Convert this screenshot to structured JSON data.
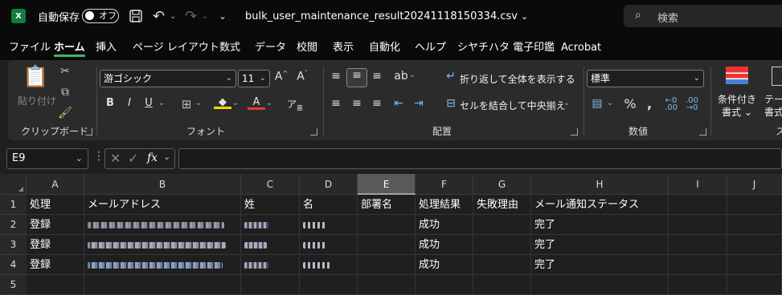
{
  "titlebar": {
    "app_logo": "X",
    "autosave_label": "自動保存",
    "autosave_state": "オフ",
    "filename": "bulk_user_maintenance_result20241118150334.csv",
    "search_placeholder": "検索"
  },
  "menu": [
    "ファイル",
    "ホーム",
    "挿入",
    "ページ レイアウト",
    "数式",
    "データ",
    "校閲",
    "表示",
    "自動化",
    "ヘルプ",
    "シヤチハタ 電子印鑑",
    "Acrobat"
  ],
  "menu_active": "ホーム",
  "ribbon": {
    "clipboard": {
      "paste_label": "貼り付け",
      "group_label": "クリップボード"
    },
    "font": {
      "font_name": "游ゴシック",
      "font_size": "11",
      "group_label": "フォント"
    },
    "alignment": {
      "wrap_label": "折り返して全体を表示する",
      "merge_label": "セルを結合して中央揃え",
      "group_label": "配置"
    },
    "number": {
      "format": "標準",
      "group_label": "数値"
    },
    "styles": {
      "conditional_line1": "条件付き",
      "conditional_line2": "書式",
      "table_line1": "テーブ",
      "table_line2": "書式",
      "group_label_partial": "ス"
    }
  },
  "formula_bar": {
    "name_box": "E9",
    "fx": "fx",
    "content": ""
  },
  "sheet": {
    "columns": [
      "A",
      "B",
      "C",
      "D",
      "E",
      "F",
      "G",
      "H",
      "I",
      "J"
    ],
    "selected_column": "E",
    "rows": [
      "1",
      "2",
      "3",
      "4",
      "5"
    ],
    "header_row": [
      "処理",
      "メールアドレス",
      "姓",
      "名",
      "部署名",
      "処理結果",
      "失敗理由",
      "メール通知ステータス",
      "",
      ""
    ],
    "data_rows": [
      [
        "登録",
        "",
        "",
        "",
        "",
        "成功",
        "",
        "完了",
        "",
        ""
      ],
      [
        "登録",
        "",
        "",
        "",
        "",
        "成功",
        "",
        "完了",
        "",
        ""
      ],
      [
        "登録",
        "",
        "",
        "",
        "",
        "成功",
        "",
        "完了",
        "",
        ""
      ],
      [
        "",
        "",
        "",
        "",
        "",
        "",
        "",
        "",
        "",
        ""
      ]
    ]
  },
  "colors": {
    "accent": "#3fb66c",
    "excel_green": "#107c41"
  }
}
